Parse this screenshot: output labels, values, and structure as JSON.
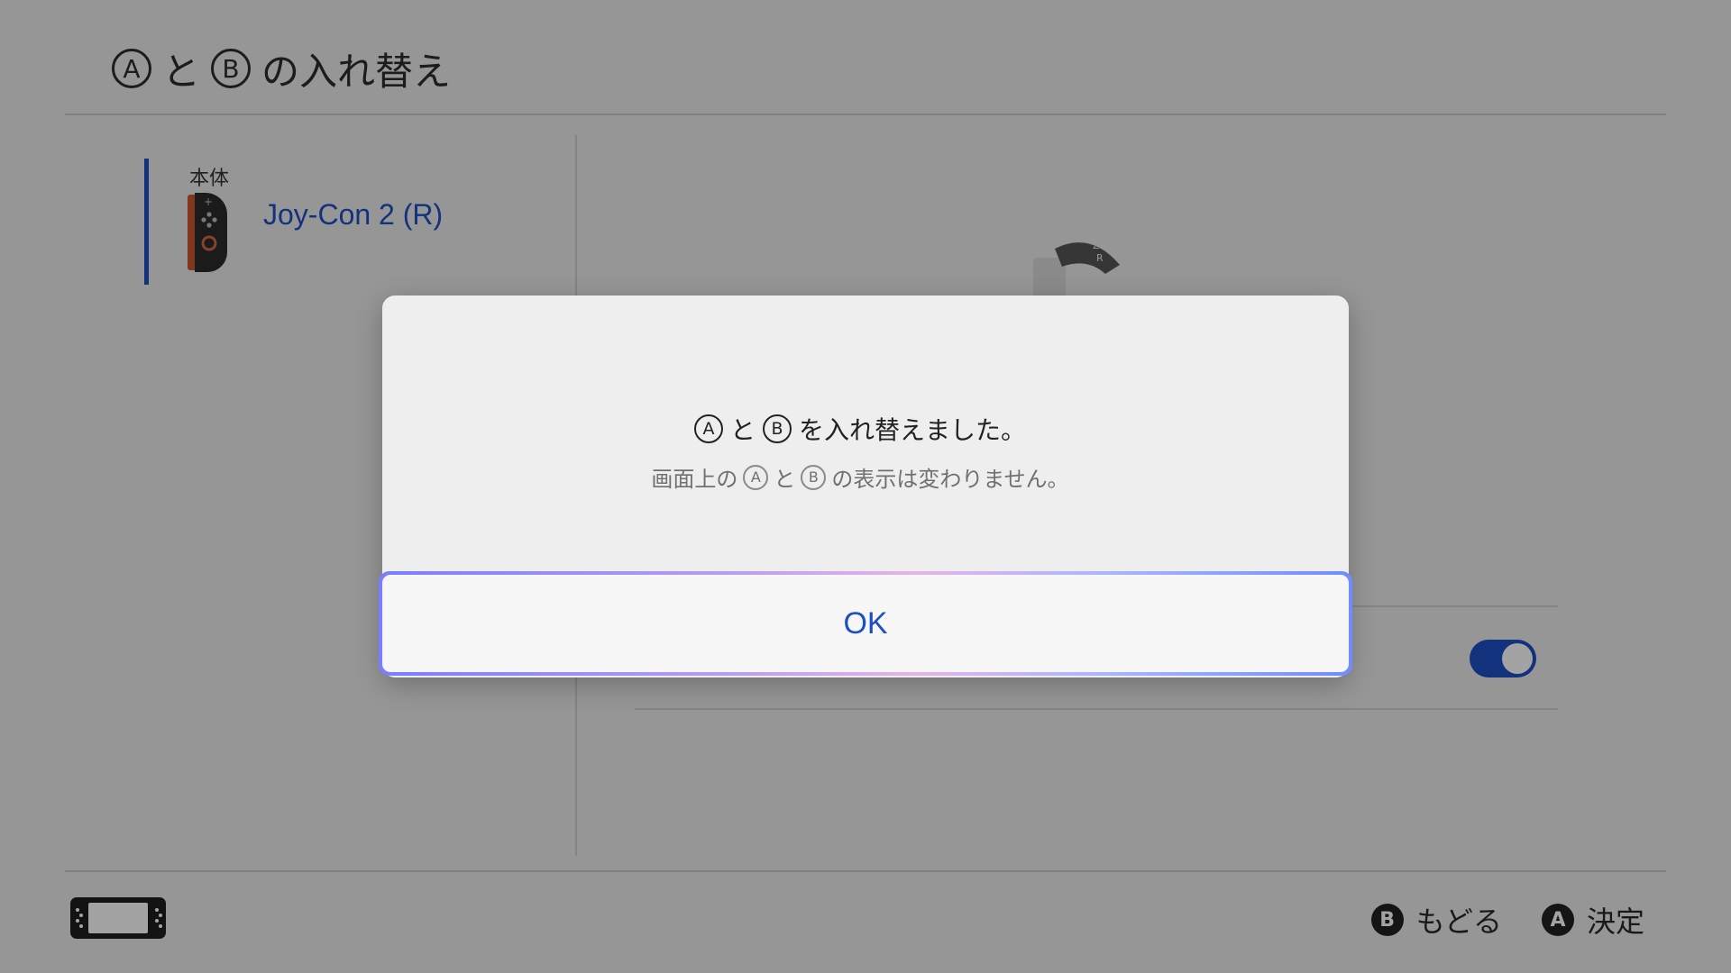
{
  "header": {
    "title_letter_a": "A",
    "title_to": "と",
    "title_letter_b": "B",
    "title_rest": "の入れ替え"
  },
  "sidebar": {
    "caption": "本体",
    "device_name": "Joy-Con 2 (R)"
  },
  "dialog": {
    "line1_letter_a": "A",
    "line1_to": "と",
    "line1_letter_b": "B",
    "line1_rest": "を入れ替えました。",
    "line2_prefix": "画面上の",
    "line2_letter_a": "A",
    "line2_to": "と",
    "line2_letter_b": "B",
    "line2_rest": "の表示は変わりません。",
    "ok_label": "OK"
  },
  "settings": {
    "toggle_on": true
  },
  "footer": {
    "back_button": "B",
    "back_label": "もどる",
    "confirm_button": "A",
    "confirm_label": "決定"
  },
  "colors": {
    "accent": "#1d4fc4",
    "dialog_bg": "#eeeeee",
    "screen_bg": "#ebebeb"
  },
  "icons": [
    "joycon-r-icon",
    "console-icon",
    "joycon-graphic-icon"
  ]
}
